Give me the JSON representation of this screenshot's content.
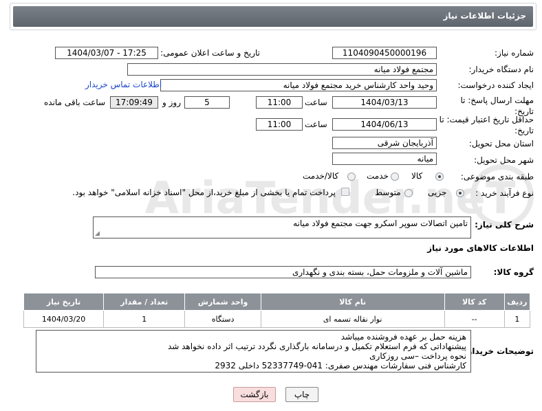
{
  "header": {
    "title": "جزئیات اطلاعات نیاز"
  },
  "form": {
    "need_number_label": "شماره نیاز:",
    "need_number": "1104090450000196",
    "announce_label": "تاریخ و ساعت اعلان عمومی:",
    "announce_value": "1404/03/07 - 17:25",
    "buyer_org_label": "نام دستگاه خریدار:",
    "buyer_org": "مجتمع فولاد میانه",
    "creator_label": "ایجاد کننده درخواست:",
    "creator": "وحید واحد کارشناس خرید مجتمع فولاد میانه",
    "contact_link": "اطلاعات تماس خریدار",
    "deadline_label": "مهلت ارسال پاسخ: تا تاریخ:",
    "deadline_date": "1404/03/13",
    "time_label": "ساعت",
    "deadline_time": "11:00",
    "days_value": "5",
    "days_label": "روز و",
    "remaining_time": "17:09:49",
    "remaining_label": "ساعت باقی مانده",
    "validity_label": "حداقل تاریخ اعتبار قیمت: تا تاریخ:",
    "validity_date": "1404/06/13",
    "validity_time": "11:00",
    "province_label": "استان محل تحویل:",
    "province": "آذربایجان شرقی",
    "city_label": "شهر محل تحویل:",
    "city": "میانه",
    "category_label": "طبقه بندی موضوعی:",
    "category_options": [
      "کالا",
      "خدمت",
      "کالا/خدمت"
    ],
    "process_label": "نوع فرآیند خرید :",
    "process_options": [
      "جزیی",
      "متوسط"
    ],
    "payment_note": "پرداخت تمام یا بخشی از مبلغ خرید،از محل \"اسناد خزانه اسلامی\" خواهد بود."
  },
  "description": {
    "label": "شرح کلی نیاز:",
    "value": "تامین اتصالات سوپر اسکرو جهت مجتمع فولاد میانه"
  },
  "goods_info": {
    "title": "اطلاعات کالاهای مورد نیاز",
    "group_label": "گروه کالا:",
    "group_value": "ماشین آلات و ملزومات حمل، بسته بندی و نگهداری"
  },
  "table": {
    "headers": [
      "ردیف",
      "کد کالا",
      "نام کالا",
      "واحد شمارش",
      "تعداد / مقدار",
      "تاریخ نیاز"
    ],
    "rows": [
      [
        "1",
        "--",
        "نوار نقاله تسمه ای",
        "دستگاه",
        "1",
        "1404/03/20"
      ]
    ]
  },
  "buyer_notes": {
    "label": "توضیحات خریدار:",
    "lines": [
      "هزینه حمل بر عهده فروشنده میباشد",
      "پیشنهاداتی که فرم استعلام تکمیل و درسامانه بارگذاری نگردد ترتیب اثر داده نخواهد شد",
      "نحوه پرداخت –سی روزکاری",
      "کارشناس فنی سفارشات مهندس صفری:  041-52337749  داخلی 2932"
    ]
  },
  "buttons": {
    "print": "چاپ",
    "back": "بازگشت"
  },
  "watermark": {
    "text": "AriaTender.neT"
  }
}
